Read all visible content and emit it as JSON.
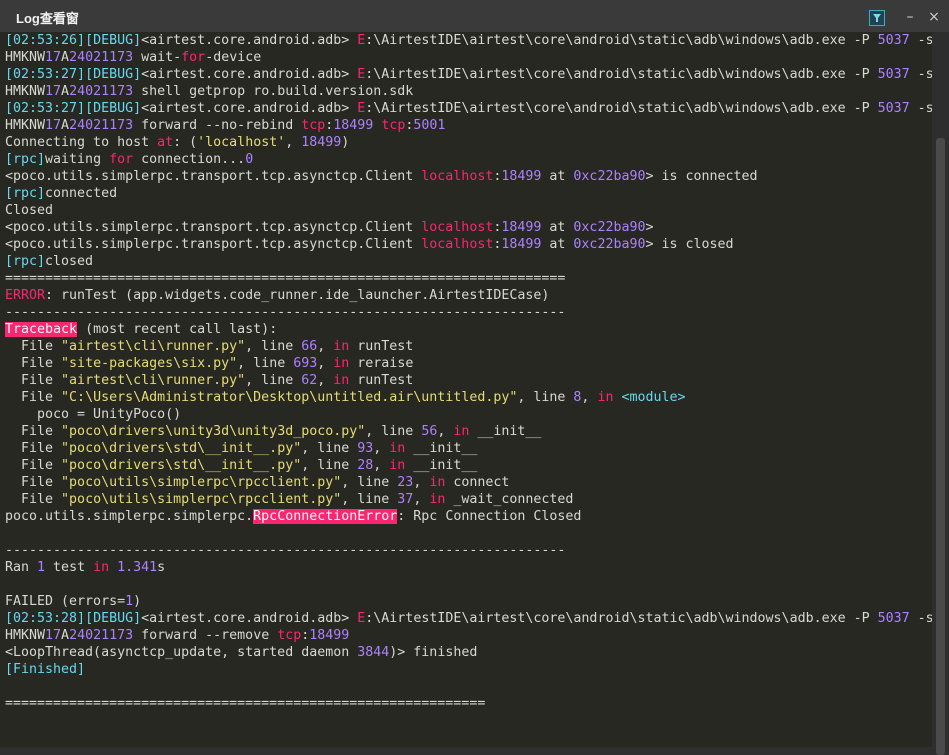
{
  "window": {
    "title": "Log查看窗",
    "minimize_glyph": "–",
    "close_glyph": "×",
    "filter_icon": "filter-icon"
  },
  "log_lines": [
    [
      [
        "[02:53:26]",
        "ts"
      ],
      [
        "[DEBUG]",
        "ts"
      ],
      [
        "<airtest.core.android.adb> ",
        ""
      ],
      [
        "E",
        "red"
      ],
      [
        ":\\AirtestIDE\\airtest\\core\\android\\static\\adb\\windows\\adb.exe -P ",
        ""
      ],
      [
        "5037",
        "num"
      ],
      [
        " -s",
        ""
      ]
    ],
    [
      [
        "HMKNW",
        ""
      ],
      [
        "17",
        "num"
      ],
      [
        "A",
        ""
      ],
      [
        "24021173",
        "num"
      ],
      [
        " wait-",
        ""
      ],
      [
        "for",
        "kw"
      ],
      [
        "-device",
        ""
      ]
    ],
    [
      [
        "[02:53:27]",
        "ts"
      ],
      [
        "[DEBUG]",
        "ts"
      ],
      [
        "<airtest.core.android.adb> ",
        ""
      ],
      [
        "E",
        "red"
      ],
      [
        ":\\AirtestIDE\\airtest\\core\\android\\static\\adb\\windows\\adb.exe -P ",
        ""
      ],
      [
        "5037",
        "num"
      ],
      [
        " -s",
        ""
      ]
    ],
    [
      [
        "HMKNW",
        ""
      ],
      [
        "17",
        "num"
      ],
      [
        "A",
        ""
      ],
      [
        "24021173",
        "num"
      ],
      [
        " shell getprop ro.build.version.sdk",
        ""
      ]
    ],
    [
      [
        "[02:53:27]",
        "ts"
      ],
      [
        "[DEBUG]",
        "ts"
      ],
      [
        "<airtest.core.android.adb> ",
        ""
      ],
      [
        "E",
        "red"
      ],
      [
        ":\\AirtestIDE\\airtest\\core\\android\\static\\adb\\windows\\adb.exe -P ",
        ""
      ],
      [
        "5037",
        "num"
      ],
      [
        " -s",
        ""
      ]
    ],
    [
      [
        "HMKNW",
        ""
      ],
      [
        "17",
        "num"
      ],
      [
        "A",
        ""
      ],
      [
        "24021173",
        "num"
      ],
      [
        " forward --no-rebind ",
        ""
      ],
      [
        "tcp",
        "kw"
      ],
      [
        ":",
        ""
      ],
      [
        "18499",
        "num"
      ],
      [
        " ",
        ""
      ],
      [
        "tcp",
        "kw"
      ],
      [
        ":",
        ""
      ],
      [
        "5001",
        "num"
      ]
    ],
    [
      [
        "Connecting to host ",
        ""
      ],
      [
        "at",
        "kw"
      ],
      [
        ": (",
        ""
      ],
      [
        "'localhost'",
        "str"
      ],
      [
        ", ",
        ""
      ],
      [
        "18499",
        "num"
      ],
      [
        ")",
        ""
      ]
    ],
    [
      [
        "[rpc]",
        "ts"
      ],
      [
        "waiting ",
        ""
      ],
      [
        "for",
        "kw"
      ],
      [
        " connection...",
        ""
      ],
      [
        "0",
        "num"
      ]
    ],
    [
      [
        "<poco.utils.simplerpc.transport.tcp.asynctcp.Client ",
        ""
      ],
      [
        "localhost",
        "kw"
      ],
      [
        ":",
        ""
      ],
      [
        "18499",
        "num"
      ],
      [
        " at ",
        ""
      ],
      [
        "0xc22ba90",
        "num"
      ],
      [
        "> is connected",
        ""
      ]
    ],
    [
      [
        "[rpc]",
        "ts"
      ],
      [
        "connected",
        ""
      ]
    ],
    [
      [
        "Closed",
        ""
      ]
    ],
    [
      [
        "<poco.utils.simplerpc.transport.tcp.asynctcp.Client ",
        ""
      ],
      [
        "localhost",
        "kw"
      ],
      [
        ":",
        ""
      ],
      [
        "18499",
        "num"
      ],
      [
        " at ",
        ""
      ],
      [
        "0xc22ba90",
        "num"
      ],
      [
        ">",
        ""
      ]
    ],
    [
      [
        "<poco.utils.simplerpc.transport.tcp.asynctcp.Client ",
        ""
      ],
      [
        "localhost",
        "kw"
      ],
      [
        ":",
        ""
      ],
      [
        "18499",
        "num"
      ],
      [
        " at ",
        ""
      ],
      [
        "0xc22ba90",
        "num"
      ],
      [
        "> is closed",
        ""
      ]
    ],
    [
      [
        "[rpc]",
        "ts"
      ],
      [
        "closed",
        ""
      ]
    ],
    [
      [
        "======================================================================",
        ""
      ]
    ],
    [
      [
        "ERROR",
        "red"
      ],
      [
        ": runTest (app.widgets.code_runner.ide_launcher.AirtestIDECase)",
        ""
      ]
    ],
    [
      [
        "----------------------------------------------------------------------",
        ""
      ]
    ],
    [
      [
        "Traceback",
        "hl"
      ],
      [
        " (most recent call last):",
        ""
      ]
    ],
    [
      [
        "  File ",
        ""
      ],
      [
        "\"airtest\\cli\\runner.py\"",
        "str"
      ],
      [
        ", line ",
        ""
      ],
      [
        "66",
        "num"
      ],
      [
        ", ",
        ""
      ],
      [
        "in",
        "kw"
      ],
      [
        " runTest",
        ""
      ]
    ],
    [
      [
        "  File ",
        ""
      ],
      [
        "\"site-packages\\six.py\"",
        "str"
      ],
      [
        ", line ",
        ""
      ],
      [
        "693",
        "num"
      ],
      [
        ", ",
        ""
      ],
      [
        "in",
        "kw"
      ],
      [
        " reraise",
        ""
      ]
    ],
    [
      [
        "  File ",
        ""
      ],
      [
        "\"airtest\\cli\\runner.py\"",
        "str"
      ],
      [
        ", line ",
        ""
      ],
      [
        "62",
        "num"
      ],
      [
        ", ",
        ""
      ],
      [
        "in",
        "kw"
      ],
      [
        " runTest",
        ""
      ]
    ],
    [
      [
        "  File ",
        ""
      ],
      [
        "\"C:\\Users\\Administrator\\Desktop\\untitled.air\\untitled.py\"",
        "str"
      ],
      [
        ", line ",
        ""
      ],
      [
        "8",
        "num"
      ],
      [
        ", ",
        ""
      ],
      [
        "in",
        "kw"
      ],
      [
        " ",
        ""
      ],
      [
        "<module>",
        "ts"
      ]
    ],
    [
      [
        "    poco = UnityPoco()",
        ""
      ]
    ],
    [
      [
        "  File ",
        ""
      ],
      [
        "\"poco\\drivers\\unity3d\\unity3d_poco.py\"",
        "str"
      ],
      [
        ", line ",
        ""
      ],
      [
        "56",
        "num"
      ],
      [
        ", ",
        ""
      ],
      [
        "in",
        "kw"
      ],
      [
        " __init__",
        ""
      ]
    ],
    [
      [
        "  File ",
        ""
      ],
      [
        "\"poco\\drivers\\std\\__init__.py\"",
        "str"
      ],
      [
        ", line ",
        ""
      ],
      [
        "93",
        "num"
      ],
      [
        ", ",
        ""
      ],
      [
        "in",
        "kw"
      ],
      [
        " __init__",
        ""
      ]
    ],
    [
      [
        "  File ",
        ""
      ],
      [
        "\"poco\\drivers\\std\\__init__.py\"",
        "str"
      ],
      [
        ", line ",
        ""
      ],
      [
        "28",
        "num"
      ],
      [
        ", ",
        ""
      ],
      [
        "in",
        "kw"
      ],
      [
        " __init__",
        ""
      ]
    ],
    [
      [
        "  File ",
        ""
      ],
      [
        "\"poco\\utils\\simplerpc\\rpcclient.py\"",
        "str"
      ],
      [
        ", line ",
        ""
      ],
      [
        "23",
        "num"
      ],
      [
        ", ",
        ""
      ],
      [
        "in",
        "kw"
      ],
      [
        " connect",
        ""
      ]
    ],
    [
      [
        "  File ",
        ""
      ],
      [
        "\"poco\\utils\\simplerpc\\rpcclient.py\"",
        "str"
      ],
      [
        ", line ",
        ""
      ],
      [
        "37",
        "num"
      ],
      [
        ", ",
        ""
      ],
      [
        "in",
        "kw"
      ],
      [
        " _wait_connected",
        ""
      ]
    ],
    [
      [
        "poco.utils.simplerpc.simplerpc.",
        ""
      ],
      [
        "RpcConnectionError",
        "hl"
      ],
      [
        ": Rpc Connection Closed",
        ""
      ]
    ],
    [
      [
        "",
        ""
      ]
    ],
    [
      [
        "----------------------------------------------------------------------",
        ""
      ]
    ],
    [
      [
        "Ran ",
        ""
      ],
      [
        "1",
        "num"
      ],
      [
        " test ",
        ""
      ],
      [
        "in",
        "kw"
      ],
      [
        " ",
        ""
      ],
      [
        "1.341",
        "num"
      ],
      [
        "s",
        ""
      ]
    ],
    [
      [
        "",
        ""
      ]
    ],
    [
      [
        "FAILED (errors=",
        ""
      ],
      [
        "1",
        "num"
      ],
      [
        ")",
        ""
      ]
    ],
    [
      [
        "[02:53:28]",
        "ts"
      ],
      [
        "[DEBUG]",
        "ts"
      ],
      [
        "<airtest.core.android.adb> ",
        ""
      ],
      [
        "E",
        "red"
      ],
      [
        ":\\AirtestIDE\\airtest\\core\\android\\static\\adb\\windows\\adb.exe -P ",
        ""
      ],
      [
        "5037",
        "num"
      ],
      [
        " -s",
        ""
      ]
    ],
    [
      [
        "HMKNW",
        ""
      ],
      [
        "17",
        "num"
      ],
      [
        "A",
        ""
      ],
      [
        "24021173",
        "num"
      ],
      [
        " forward --remove ",
        ""
      ],
      [
        "tcp",
        "kw"
      ],
      [
        ":",
        ""
      ],
      [
        "18499",
        "num"
      ]
    ],
    [
      [
        "<LoopThread(asynctcp_update, started daemon ",
        ""
      ],
      [
        "3844",
        "num"
      ],
      [
        ")> finished",
        ""
      ]
    ],
    [
      [
        "[Finished]",
        "ts"
      ]
    ],
    [
      [
        "",
        ""
      ]
    ],
    [
      [
        "============================================================",
        ""
      ]
    ]
  ]
}
